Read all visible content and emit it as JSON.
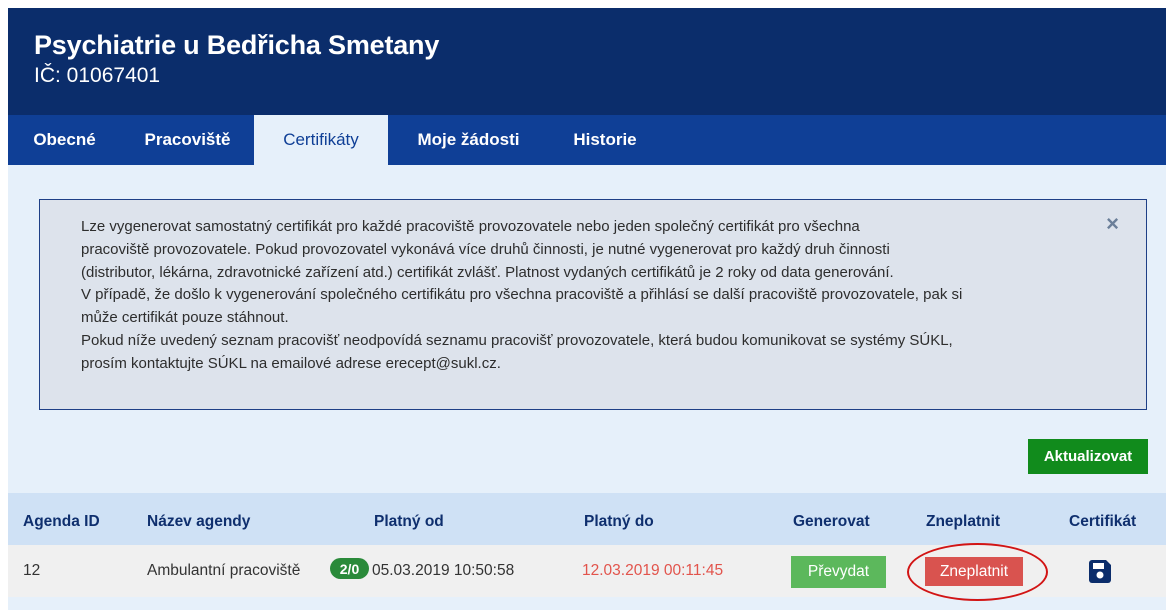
{
  "header": {
    "title": "Psychiatrie u Bedřicha Smetany",
    "ic": "IČ: 01067401"
  },
  "tabs": [
    {
      "label": "Obecné",
      "active": false
    },
    {
      "label": "Pracoviště",
      "active": false
    },
    {
      "label": "Certifikáty",
      "active": true
    },
    {
      "label": "Moje žádosti",
      "active": false
    },
    {
      "label": "Historie",
      "active": false
    }
  ],
  "alert": {
    "lines": [
      "Lze vygenerovat samostatný certifikát pro každé pracoviště provozovatele nebo jeden společný certifikát pro všechna",
      "pracoviště provozovatele. Pokud provozovatel vykonává více druhů činnosti, je nutné vygenerovat pro každý druh činnosti",
      "(distributor, lékárna, zdravotnické zařízení atd.) certifikát zvlášť. Platnost vydaných certifikátů je 2 roky od data generování.",
      "V případě, že došlo k vygenerování společného certifikátu pro všechna pracoviště a přihlásí se další pracoviště provozovatele, pak si",
      "může certifikát pouze stáhnout.",
      "Pokud níže uvedený seznam pracovišť neodpovídá seznamu pracovišť provozovatele, která budou komunikovat se systémy SÚKL,",
      "prosím kontaktujte SÚKL na emailové adrese erecept@sukl.cz."
    ],
    "close": "×"
  },
  "actions": {
    "refresh_label": "Aktualizovat"
  },
  "table": {
    "headers": {
      "agenda_id": "Agenda ID",
      "name": "Název agendy",
      "valid_from": "Platný od",
      "valid_to": "Platný do",
      "generate": "Generovat",
      "invalidate": "Zneplatnit",
      "certificate": "Certifikát"
    },
    "rows": [
      {
        "agenda_id": "12",
        "name": "Ambulantní pracoviště",
        "badge": "2/0",
        "valid_from": "05.03.2019 10:50:58",
        "valid_to": "12.03.2019 00:11:45",
        "generate_label": "Převydat",
        "invalidate_label": "Zneplatnit",
        "certificate_icon": "floppy-disk-icon"
      }
    ]
  },
  "colors": {
    "header_bg": "#0b2d6b",
    "tabs_bg": "#0f3f96",
    "page_bg": "#e6f0fa",
    "refresh_btn": "#118b1c",
    "generate_btn": "#5cb85c",
    "invalidate_btn": "#d9534f",
    "expired_date": "#e2544c",
    "highlight_circle": "#d21414"
  }
}
